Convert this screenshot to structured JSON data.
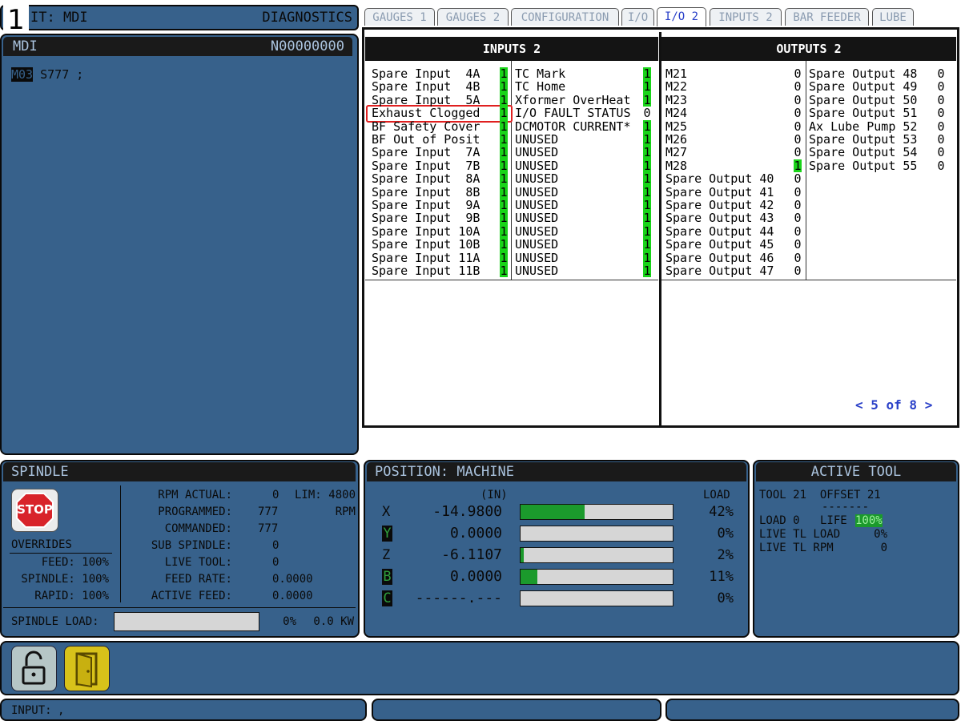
{
  "badge": "1",
  "modebar": {
    "left": "IT: MDI",
    "right": "DIAGNOSTICS"
  },
  "mdi": {
    "title": "MDI",
    "program": "N00000000",
    "line_block": "M03",
    "line_rest": " S777 ;"
  },
  "tabs": [
    "GAUGES 1",
    "GAUGES 2",
    "CONFIGURATION",
    "I/O",
    "I/O 2",
    "INPUTS 2",
    "BAR FEEDER",
    "LUBE"
  ],
  "active_tab": "I/O 2",
  "inputs_title": "INPUTS 2",
  "outputs_title": "OUTPUTS 2",
  "inputs_a": [
    {
      "name": "Spare Input  4A",
      "val": "1"
    },
    {
      "name": "Spare Input  4B",
      "val": "1"
    },
    {
      "name": "Spare Input  5A",
      "val": "1"
    },
    {
      "name": "Exhaust Clogged",
      "val": "1"
    },
    {
      "name": "BF Safety Cover",
      "val": "1"
    },
    {
      "name": "BF Out of Posit",
      "val": "1"
    },
    {
      "name": "Spare Input  7A",
      "val": "1"
    },
    {
      "name": "Spare Input  7B",
      "val": "1"
    },
    {
      "name": "Spare Input  8A",
      "val": "1"
    },
    {
      "name": "Spare Input  8B",
      "val": "1"
    },
    {
      "name": "Spare Input  9A",
      "val": "1"
    },
    {
      "name": "Spare Input  9B",
      "val": "1"
    },
    {
      "name": "Spare Input 10A",
      "val": "1"
    },
    {
      "name": "Spare Input 10B",
      "val": "1"
    },
    {
      "name": "Spare Input 11A",
      "val": "1"
    },
    {
      "name": "Spare Input 11B",
      "val": "1"
    }
  ],
  "inputs_b": [
    {
      "name": "TC Mark",
      "val": "1"
    },
    {
      "name": "TC Home",
      "val": "1"
    },
    {
      "name": "Xformer OverHeat",
      "val": "1"
    },
    {
      "name": "I/O FAULT STATUS",
      "val": "0"
    },
    {
      "name": "DCMOTOR CURRENT*",
      "val": "1"
    },
    {
      "name": "UNUSED",
      "val": "1"
    },
    {
      "name": "UNUSED",
      "val": "1"
    },
    {
      "name": "UNUSED",
      "val": "1"
    },
    {
      "name": "UNUSED",
      "val": "1"
    },
    {
      "name": "UNUSED",
      "val": "1"
    },
    {
      "name": "UNUSED",
      "val": "1"
    },
    {
      "name": "UNUSED",
      "val": "1"
    },
    {
      "name": "UNUSED",
      "val": "1"
    },
    {
      "name": "UNUSED",
      "val": "1"
    },
    {
      "name": "UNUSED",
      "val": "1"
    },
    {
      "name": "UNUSED",
      "val": "1"
    }
  ],
  "outputs_a": [
    {
      "name": "M21",
      "val": "0"
    },
    {
      "name": "M22",
      "val": "0"
    },
    {
      "name": "M23",
      "val": "0"
    },
    {
      "name": "M24",
      "val": "0"
    },
    {
      "name": "M25",
      "val": "0"
    },
    {
      "name": "M26",
      "val": "0"
    },
    {
      "name": "M27",
      "val": "0"
    },
    {
      "name": "M28",
      "val": "1"
    },
    {
      "name": "Spare Output 40",
      "val": "0"
    },
    {
      "name": "Spare Output 41",
      "val": "0"
    },
    {
      "name": "Spare Output 42",
      "val": "0"
    },
    {
      "name": "Spare Output 43",
      "val": "0"
    },
    {
      "name": "Spare Output 44",
      "val": "0"
    },
    {
      "name": "Spare Output 45",
      "val": "0"
    },
    {
      "name": "Spare Output 46",
      "val": "0"
    },
    {
      "name": "Spare Output 47",
      "val": "0"
    }
  ],
  "outputs_b": [
    {
      "name": "Spare Output 48",
      "val": "0"
    },
    {
      "name": "Spare Output 49",
      "val": "0"
    },
    {
      "name": "Spare Output 50",
      "val": "0"
    },
    {
      "name": "Spare Output 51",
      "val": "0"
    },
    {
      "name": "Ax Lube Pump 52",
      "val": "0"
    },
    {
      "name": "Spare Output 53",
      "val": "0"
    },
    {
      "name": "Spare Output 54",
      "val": "0"
    },
    {
      "name": "Spare Output 55",
      "val": "0"
    }
  ],
  "pager": "< 5 of 8 >",
  "spindle": {
    "title": "SPINDLE",
    "stop_label": "STOP",
    "overrides_label": "OVERRIDES",
    "feed": "FEED: 100%",
    "spindle": "SPINDLE: 100%",
    "rapid": "RAPID: 100%",
    "rows": [
      {
        "label": "RPM ACTUAL:",
        "value": "0",
        "extra_label": "LIM:",
        "extra": "4800"
      },
      {
        "label": "PROGRAMMED:",
        "value": "777",
        "extra_label": "",
        "extra": "RPM"
      },
      {
        "label": "COMMANDED:",
        "value": "777",
        "extra_label": "",
        "extra": ""
      },
      {
        "label": "SUB SPINDLE:",
        "value": "0",
        "extra_label": "",
        "extra": ""
      },
      {
        "label": "LIVE TOOL:",
        "value": "0",
        "extra_label": "",
        "extra": ""
      },
      {
        "label": "FEED RATE:",
        "value": "0.0000",
        "extra_label": "",
        "extra": ""
      },
      {
        "label": "ACTIVE FEED:",
        "value": "0.0000",
        "extra_label": "",
        "extra": ""
      }
    ],
    "load_label": "SPINDLE LOAD:",
    "load_pct": "0%",
    "load_kw": "0.0 KW",
    "load_fraction": 0
  },
  "position": {
    "title": "POSITION: MACHINE",
    "units": "(IN)",
    "load_header": "LOAD",
    "axes": [
      {
        "axis": "X",
        "value": "-14.9800",
        "load": "42%",
        "fraction": 0.42,
        "blk": false
      },
      {
        "axis": "Y",
        "value": "0.0000",
        "load": "0%",
        "fraction": 0.0,
        "blk": true
      },
      {
        "axis": "Z",
        "value": "-6.1107",
        "load": "2%",
        "fraction": 0.02,
        "blk": false
      },
      {
        "axis": "B",
        "value": "0.0000",
        "load": "11%",
        "fraction": 0.11,
        "blk": true
      },
      {
        "axis": "C",
        "value": "------.---",
        "load": "0%",
        "fraction": 0.0,
        "blk": true
      }
    ]
  },
  "tool": {
    "title": "ACTIVE TOOL",
    "line1": "TOOL 21  OFFSET 21",
    "dashes": "-------",
    "load_label": "LOAD 0",
    "life_label": "LIFE",
    "life_value": "100%",
    "live_load_label": "LIVE TL LOAD",
    "live_load_value": "0%",
    "live_rpm_label": "LIVE TL RPM",
    "live_rpm_value": "0"
  },
  "input_bar": {
    "label": "INPUT:",
    "value": ","
  },
  "colors": {
    "panel": "#37618b",
    "on": "#19d419",
    "accent": "#2a40c8",
    "highlight": "#e02020"
  }
}
